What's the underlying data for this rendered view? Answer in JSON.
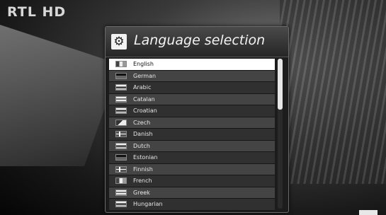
{
  "channel": {
    "logo": "RTL HD"
  },
  "dialog": {
    "title": "Language selection",
    "icon": "gear-icon",
    "languages": [
      {
        "label": "English",
        "flag": "bars-v",
        "selected": true
      },
      {
        "label": "German",
        "flag": "dark"
      },
      {
        "label": "Arabic",
        "flag": "bars-h"
      },
      {
        "label": "Catalan",
        "flag": "stripes"
      },
      {
        "label": "Croatian",
        "flag": "bars-h"
      },
      {
        "label": "Czech",
        "flag": "tri"
      },
      {
        "label": "Danish",
        "flag": "cross"
      },
      {
        "label": "Dutch",
        "flag": "bars-h"
      },
      {
        "label": "Estonian",
        "flag": "dark"
      },
      {
        "label": "Finnish",
        "flag": "cross"
      },
      {
        "label": "French",
        "flag": "bars-v"
      },
      {
        "label": "Greek",
        "flag": "stripes"
      },
      {
        "label": "Hungarian",
        "flag": "bars-h"
      }
    ],
    "scroll_position": 0.0
  }
}
